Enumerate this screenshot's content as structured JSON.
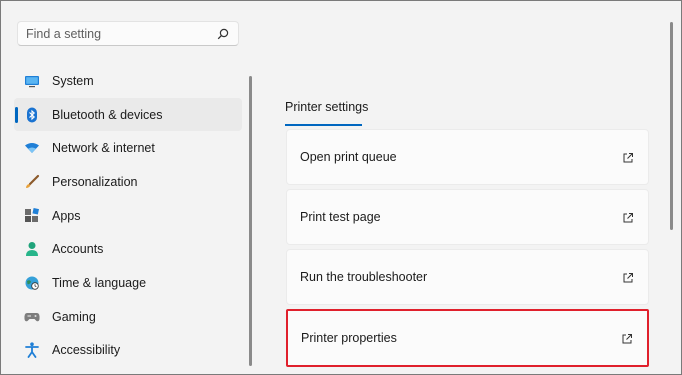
{
  "search": {
    "placeholder": "Find a setting",
    "icon": "search-icon"
  },
  "sidebar": {
    "items": [
      {
        "label": "System",
        "icon": "monitor-icon"
      },
      {
        "label": "Bluetooth & devices",
        "icon": "bluetooth-icon",
        "active": true
      },
      {
        "label": "Network & internet",
        "icon": "wifi-icon"
      },
      {
        "label": "Personalization",
        "icon": "paintbrush-icon"
      },
      {
        "label": "Apps",
        "icon": "apps-icon"
      },
      {
        "label": "Accounts",
        "icon": "person-icon"
      },
      {
        "label": "Time & language",
        "icon": "globe-clock-icon"
      },
      {
        "label": "Gaming",
        "icon": "gamepad-icon"
      },
      {
        "label": "Accessibility",
        "icon": "accessibility-icon"
      }
    ]
  },
  "main": {
    "section_title": "Printer settings",
    "cards": [
      {
        "label": "Open print queue",
        "icon": "external-link-icon"
      },
      {
        "label": "Print test page",
        "icon": "external-link-icon"
      },
      {
        "label": "Run the troubleshooter",
        "icon": "external-link-icon"
      },
      {
        "label": "Printer properties",
        "icon": "external-link-icon",
        "highlighted": true
      }
    ]
  },
  "colors": {
    "accent": "#0067c0",
    "highlight": "#e0202c",
    "background": "#f3f3f3",
    "card": "#fbfbfb"
  }
}
